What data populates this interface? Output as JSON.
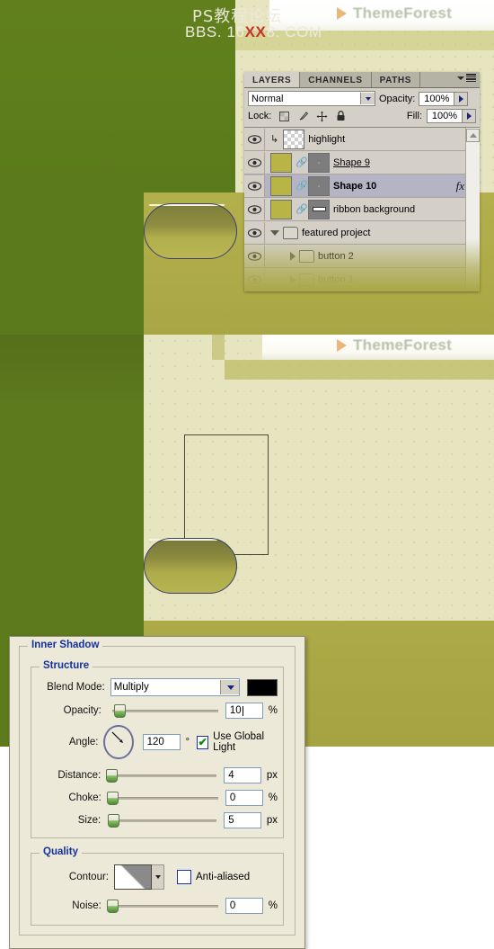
{
  "watermark": {
    "line1": "PS教程论坛",
    "line2_pre": "BBS. 16",
    "line2_hl": "XX",
    "line2_post": "8. COM"
  },
  "brand": {
    "name": "ThemeForest"
  },
  "layers_panel": {
    "tabs": [
      {
        "label": "LAYERS",
        "active": true
      },
      {
        "label": "CHANNELS",
        "active": false
      },
      {
        "label": "PATHS",
        "active": false
      }
    ],
    "blend_mode": "Normal",
    "opacity_label": "Opacity:",
    "opacity_value": "100%",
    "lock_label": "Lock:",
    "fill_label": "Fill:",
    "fill_value": "100%",
    "lock_icons": [
      "transparency-lock-icon",
      "brush-lock-icon",
      "move-lock-icon",
      "all-lock-icon"
    ],
    "layers": [
      {
        "name": "highlight",
        "thumb": "checker",
        "clipped": true,
        "mask": false,
        "fx": false,
        "state": "normal",
        "indent": 0
      },
      {
        "name": "Shape 9",
        "thumb": "olive",
        "clipped": false,
        "mask": true,
        "fx": false,
        "state": "normal",
        "indent": 0,
        "underline": true
      },
      {
        "name": "Shape 10",
        "thumb": "olive",
        "clipped": false,
        "mask": true,
        "fx": true,
        "state": "selected",
        "indent": 0,
        "bold": true
      },
      {
        "name": "ribbon background",
        "thumb": "olive",
        "clipped": false,
        "mask": true,
        "fx": false,
        "state": "normal",
        "indent": 0
      },
      {
        "name": "featured project",
        "thumb": "folder",
        "clipped": false,
        "mask": false,
        "fx": false,
        "state": "normal",
        "indent": 0,
        "group": true,
        "expanded": true
      },
      {
        "name": "button 2",
        "thumb": "folder",
        "clipped": false,
        "mask": false,
        "fx": false,
        "state": "highlight",
        "indent": 1,
        "group": true,
        "expanded": false
      },
      {
        "name": "button 1",
        "thumb": "folder",
        "clipped": false,
        "mask": false,
        "fx": false,
        "state": "faded",
        "indent": 1,
        "group": true,
        "expanded": false
      }
    ],
    "fx_label": "fx"
  },
  "inner_shadow_dialog": {
    "title": "Inner Shadow",
    "structure": {
      "title": "Structure",
      "blend_mode_label": "Blend Mode:",
      "blend_mode_value": "Multiply",
      "shadow_color": "#000000",
      "opacity_label": "Opacity:",
      "opacity_value": "10",
      "opacity_unit": "%",
      "angle_label": "Angle:",
      "angle_value": "120",
      "angle_unit": "°",
      "use_global_light_label": "Use Global Light",
      "use_global_light_checked": true,
      "distance_label": "Distance:",
      "distance_value": "4",
      "distance_unit": "px",
      "choke_label": "Choke:",
      "choke_value": "0",
      "choke_unit": "%",
      "size_label": "Size:",
      "size_value": "5",
      "size_unit": "px"
    },
    "quality": {
      "title": "Quality",
      "contour_label": "Contour:",
      "anti_aliased_label": "Anti-aliased",
      "anti_aliased_checked": false,
      "noise_label": "Noise:",
      "noise_value": "0",
      "noise_unit": "%"
    }
  },
  "colors": {
    "green_dark": "#5d7a1c",
    "olive": "#a9a745",
    "cream": "#e6e5c0",
    "panel_gray": "#d4d0c8",
    "dialog_bg": "#ece9d8",
    "heading_blue": "#14319e",
    "accent_orange": "#e08a2b"
  }
}
